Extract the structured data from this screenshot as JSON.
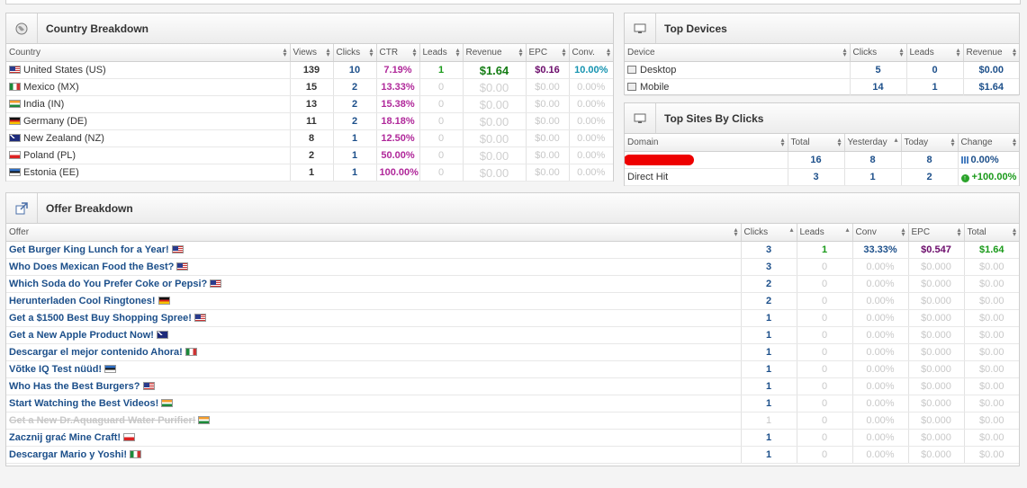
{
  "country": {
    "title": "Country Breakdown",
    "headers": [
      "Country",
      "Views",
      "Clicks",
      "CTR",
      "Leads",
      "Revenue",
      "EPC",
      "Conv."
    ],
    "rows": [
      {
        "flag": "us",
        "name": "United States (US)",
        "views": "139",
        "clicks": "10",
        "ctr": "7.19%",
        "leads": "1",
        "revenue": "$1.64",
        "epc": "$0.16",
        "conv": "10.00%",
        "active": true
      },
      {
        "flag": "mx",
        "name": "Mexico (MX)",
        "views": "15",
        "clicks": "2",
        "ctr": "13.33%",
        "leads": "0",
        "revenue": "$0.00",
        "epc": "$0.00",
        "conv": "0.00%",
        "active": false
      },
      {
        "flag": "in",
        "name": "India (IN)",
        "views": "13",
        "clicks": "2",
        "ctr": "15.38%",
        "leads": "0",
        "revenue": "$0.00",
        "epc": "$0.00",
        "conv": "0.00%",
        "active": false
      },
      {
        "flag": "de",
        "name": "Germany (DE)",
        "views": "11",
        "clicks": "2",
        "ctr": "18.18%",
        "leads": "0",
        "revenue": "$0.00",
        "epc": "$0.00",
        "conv": "0.00%",
        "active": false
      },
      {
        "flag": "nz",
        "name": "New Zealand (NZ)",
        "views": "8",
        "clicks": "1",
        "ctr": "12.50%",
        "leads": "0",
        "revenue": "$0.00",
        "epc": "$0.00",
        "conv": "0.00%",
        "active": false
      },
      {
        "flag": "pl",
        "name": "Poland (PL)",
        "views": "2",
        "clicks": "1",
        "ctr": "50.00%",
        "leads": "0",
        "revenue": "$0.00",
        "epc": "$0.00",
        "conv": "0.00%",
        "active": false
      },
      {
        "flag": "ee",
        "name": "Estonia (EE)",
        "views": "1",
        "clicks": "1",
        "ctr": "100.00%",
        "leads": "0",
        "revenue": "$0.00",
        "epc": "$0.00",
        "conv": "0.00%",
        "active": false
      }
    ]
  },
  "devices": {
    "title": "Top Devices",
    "headers": [
      "Device",
      "Clicks",
      "Leads",
      "Revenue"
    ],
    "rows": [
      {
        "name": "Desktop",
        "clicks": "5",
        "leads": "0",
        "revenue": "$0.00"
      },
      {
        "name": "Mobile",
        "clicks": "14",
        "leads": "1",
        "revenue": "$1.64"
      }
    ]
  },
  "sites": {
    "title": "Top Sites By Clicks",
    "headers": [
      "Domain",
      "Total",
      "Yesterday",
      "Today",
      "Change"
    ],
    "rows": [
      {
        "domain": "",
        "redacted": true,
        "total": "16",
        "yesterday": "8",
        "today": "8",
        "change": "0.00%",
        "change_type": "flat"
      },
      {
        "domain": "Direct Hit",
        "redacted": false,
        "total": "3",
        "yesterday": "1",
        "today": "2",
        "change": "+100.00%",
        "change_type": "up"
      }
    ]
  },
  "offers": {
    "title": "Offer Breakdown",
    "headers": [
      "Offer",
      "Clicks",
      "Leads",
      "Conv",
      "EPC",
      "Total"
    ],
    "rows": [
      {
        "name": "Get Burger King Lunch for a Year!",
        "flag": "us",
        "clicks": "3",
        "leads": "1",
        "conv": "33.33%",
        "epc": "$0.547",
        "total": "$1.64",
        "active": true,
        "disabled": false
      },
      {
        "name": "Who Does Mexican Food the Best?",
        "flag": "us",
        "clicks": "3",
        "leads": "0",
        "conv": "0.00%",
        "epc": "$0.000",
        "total": "$0.00",
        "active": false,
        "disabled": false
      },
      {
        "name": "Which Soda do You Prefer Coke or Pepsi?",
        "flag": "us",
        "clicks": "2",
        "leads": "0",
        "conv": "0.00%",
        "epc": "$0.000",
        "total": "$0.00",
        "active": false,
        "disabled": false
      },
      {
        "name": "Herunterladen Cool Ringtones!",
        "flag": "de",
        "clicks": "2",
        "leads": "0",
        "conv": "0.00%",
        "epc": "$0.000",
        "total": "$0.00",
        "active": false,
        "disabled": false
      },
      {
        "name": "Get a $1500 Best Buy Shopping Spree!",
        "flag": "us",
        "clicks": "1",
        "leads": "0",
        "conv": "0.00%",
        "epc": "$0.000",
        "total": "$0.00",
        "active": false,
        "disabled": false
      },
      {
        "name": "Get a New Apple Product Now!",
        "flag": "nz",
        "clicks": "1",
        "leads": "0",
        "conv": "0.00%",
        "epc": "$0.000",
        "total": "$0.00",
        "active": false,
        "disabled": false
      },
      {
        "name": "Descargar el mejor contenido Ahora!",
        "flag": "mx",
        "clicks": "1",
        "leads": "0",
        "conv": "0.00%",
        "epc": "$0.000",
        "total": "$0.00",
        "active": false,
        "disabled": false
      },
      {
        "name": "Võtke IQ Test nüüd!",
        "flag": "ee",
        "clicks": "1",
        "leads": "0",
        "conv": "0.00%",
        "epc": "$0.000",
        "total": "$0.00",
        "active": false,
        "disabled": false
      },
      {
        "name": "Who Has the Best Burgers?",
        "flag": "us",
        "clicks": "1",
        "leads": "0",
        "conv": "0.00%",
        "epc": "$0.000",
        "total": "$0.00",
        "active": false,
        "disabled": false
      },
      {
        "name": "Start Watching the Best Videos!",
        "flag": "in",
        "clicks": "1",
        "leads": "0",
        "conv": "0.00%",
        "epc": "$0.000",
        "total": "$0.00",
        "active": false,
        "disabled": false
      },
      {
        "name": "Get a New Dr.Aquaguard Water Purifier!",
        "flag": "in",
        "clicks": "1",
        "leads": "0",
        "conv": "0.00%",
        "epc": "$0.000",
        "total": "$0.00",
        "active": false,
        "disabled": true
      },
      {
        "name": "Zacznij grać Mine Craft!",
        "flag": "pl",
        "clicks": "1",
        "leads": "0",
        "conv": "0.00%",
        "epc": "$0.000",
        "total": "$0.00",
        "active": false,
        "disabled": false
      },
      {
        "name": "Descargar Mario y Yoshi!",
        "flag": "mx",
        "clicks": "1",
        "leads": "0",
        "conv": "0.00%",
        "epc": "$0.000",
        "total": "$0.00",
        "active": false,
        "disabled": false
      }
    ]
  },
  "icons": {
    "country": "globe-icon",
    "devices": "monitor-icon",
    "sites": "monitor-icon",
    "offers": "external-link-icon"
  }
}
